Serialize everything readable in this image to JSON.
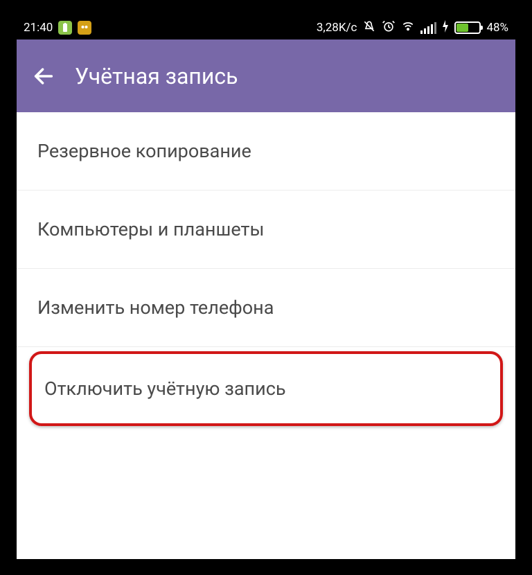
{
  "status_bar": {
    "time": "21:40",
    "data_rate": "3,28K/c",
    "battery_pct": "48%"
  },
  "app_bar": {
    "title": "Учётная запись"
  },
  "items": {
    "backup": "Резервное копирование",
    "devices": "Компьютеры и планшеты",
    "change_number": "Изменить номер телефона",
    "deactivate": "Отключить учётную запись"
  }
}
